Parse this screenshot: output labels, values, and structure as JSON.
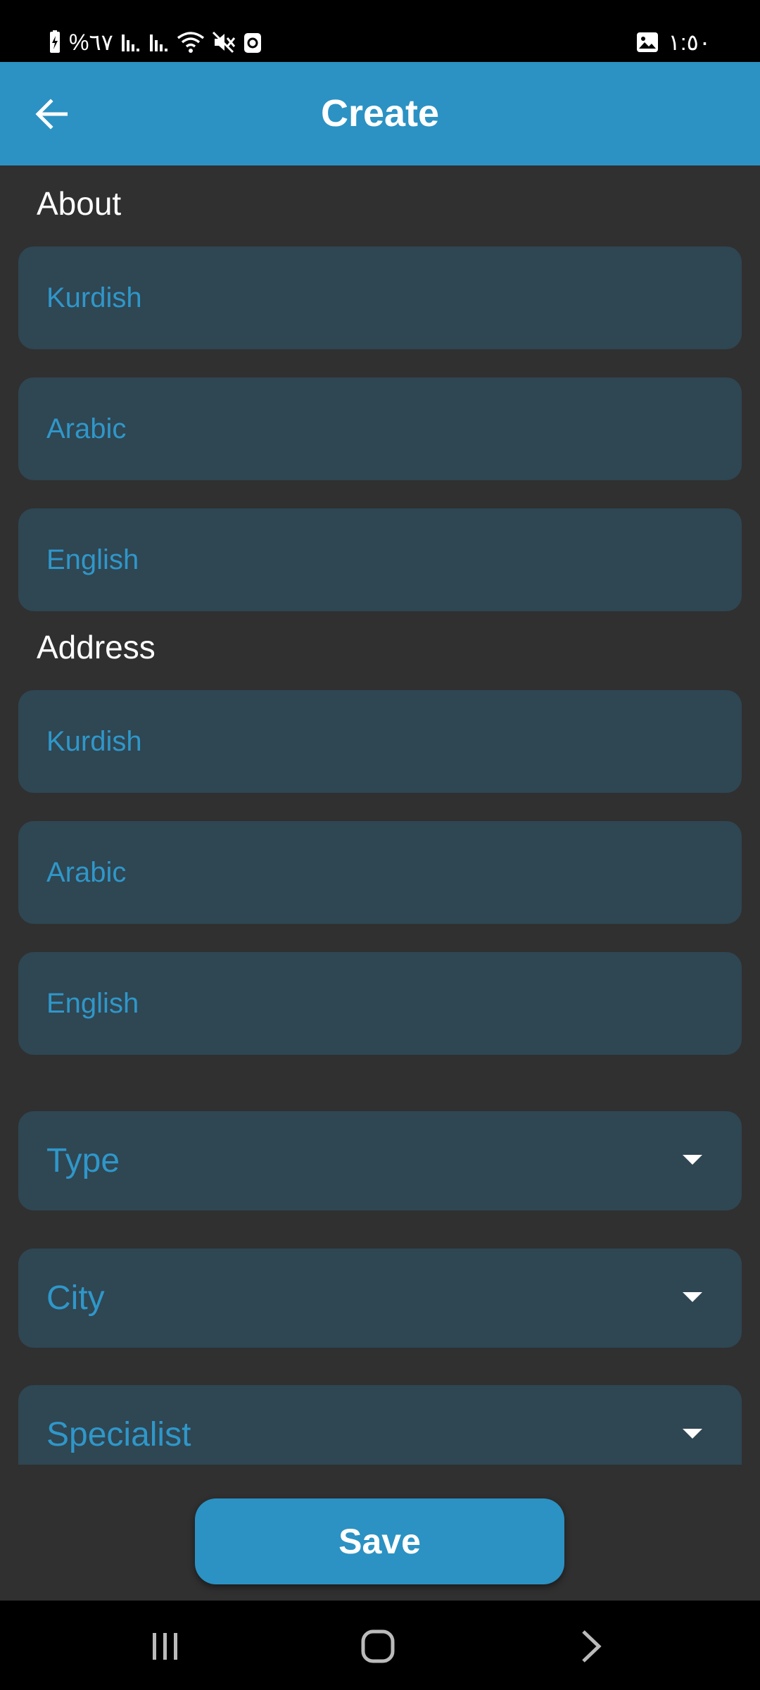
{
  "status_bar": {
    "battery_text": "%٦٧",
    "time": "١:٥٠"
  },
  "app_bar": {
    "title": "Create"
  },
  "about": {
    "label": "About",
    "fields": [
      {
        "placeholder": "Kurdish",
        "value": ""
      },
      {
        "placeholder": "Arabic",
        "value": ""
      },
      {
        "placeholder": "English",
        "value": ""
      }
    ]
  },
  "address": {
    "label": "Address",
    "fields": [
      {
        "placeholder": "Kurdish",
        "value": ""
      },
      {
        "placeholder": "Arabic",
        "value": ""
      },
      {
        "placeholder": "English",
        "value": ""
      }
    ]
  },
  "dropdowns": [
    {
      "placeholder": "Type"
    },
    {
      "placeholder": "City"
    },
    {
      "placeholder": "Specialist"
    }
  ],
  "save_label": "Save",
  "colors": {
    "primary": "#2b92c3",
    "background": "#303030",
    "field_fill": "#2f4653",
    "placeholder": "#2f97c9"
  }
}
